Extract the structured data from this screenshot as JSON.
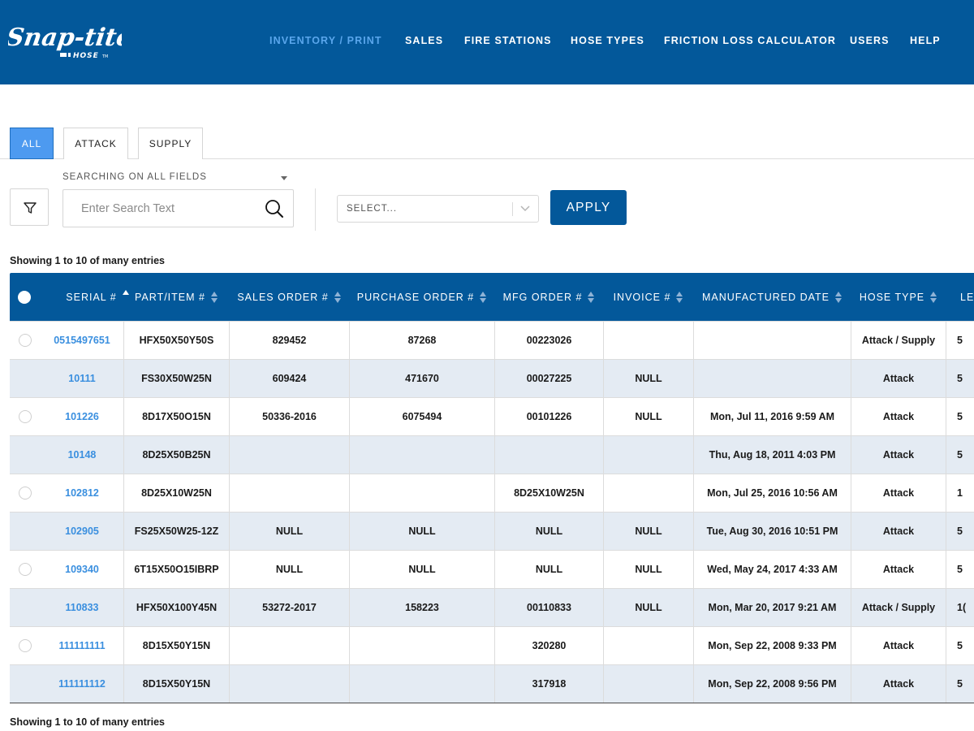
{
  "header": {
    "brand": "Snap-tite HOSE",
    "nav": [
      {
        "label": "INVENTORY / PRINT",
        "active": true
      },
      {
        "label": "SALES",
        "active": false
      },
      {
        "label": "FIRE STATIONS",
        "active": false
      },
      {
        "label": "HOSE TYPES",
        "active": false
      },
      {
        "label": "FRICTION LOSS CALCULATOR",
        "active": false
      },
      {
        "label": "USERS",
        "active": false
      },
      {
        "label": "HELP",
        "active": false
      }
    ]
  },
  "tabs": [
    {
      "label": "ALL",
      "active": true
    },
    {
      "label": "ATTACK",
      "active": false
    },
    {
      "label": "SUPPLY",
      "active": false
    }
  ],
  "search": {
    "scope_label": "SEARCHING ON ALL FIELDS",
    "placeholder": "Enter Search Text",
    "value": "",
    "select_placeholder": "SELECT...",
    "apply_label": "APPLY",
    "filter_icon": "filter-funnel-icon",
    "search_icon": "magnifier-icon"
  },
  "showing_top": "Showing 1 to 10 of many entries",
  "showing_bottom": "Showing 1 to 10 of many entries",
  "table": {
    "columns": [
      {
        "label": "SERIAL #",
        "sort": "asc"
      },
      {
        "label": "PART/ITEM #",
        "sort": "none"
      },
      {
        "label": "SALES ORDER #",
        "sort": "none"
      },
      {
        "label": "PURCHASE ORDER #",
        "sort": "none"
      },
      {
        "label": "MFG ORDER #",
        "sort": "none"
      },
      {
        "label": "INVOICE #",
        "sort": "none"
      },
      {
        "label": "MANUFACTURED DATE",
        "sort": "none"
      },
      {
        "label": "HOSE TYPE",
        "sort": "none"
      },
      {
        "label": "LE",
        "sort": "none"
      }
    ],
    "rows": [
      {
        "serial": "0515497651",
        "part": "HFX50X50Y50S",
        "sales_order": "829452",
        "purchase_order": "87268",
        "mfg_order": "00223026",
        "invoice": "",
        "date": "",
        "hose_type": "Attack / Supply",
        "le": "5"
      },
      {
        "serial": "10111",
        "part": "FS30X50W25N",
        "sales_order": "609424",
        "purchase_order": "471670",
        "mfg_order": "00027225",
        "invoice": "NULL",
        "date": "",
        "hose_type": "Attack",
        "le": "5"
      },
      {
        "serial": "101226",
        "part": "8D17X50O15N",
        "sales_order": "50336-2016",
        "purchase_order": "6075494",
        "mfg_order": "00101226",
        "invoice": "NULL",
        "date": "Mon, Jul 11, 2016 9:59 AM",
        "hose_type": "Attack",
        "le": "5"
      },
      {
        "serial": "10148",
        "part": "8D25X50B25N",
        "sales_order": "",
        "purchase_order": "",
        "mfg_order": "",
        "invoice": "",
        "date": "Thu, Aug 18, 2011 4:03 PM",
        "hose_type": "Attack",
        "le": "5"
      },
      {
        "serial": "102812",
        "part": "8D25X10W25N",
        "sales_order": "",
        "purchase_order": "",
        "mfg_order": "8D25X10W25N",
        "invoice": "",
        "date": "Mon, Jul 25, 2016 10:56 AM",
        "hose_type": "Attack",
        "le": "1"
      },
      {
        "serial": "102905",
        "part": "FS25X50W25-12Z",
        "sales_order": "NULL",
        "purchase_order": "NULL",
        "mfg_order": "NULL",
        "invoice": "NULL",
        "date": "Tue, Aug 30, 2016 10:51 PM",
        "hose_type": "Attack",
        "le": "5"
      },
      {
        "serial": "109340",
        "part": "6T15X50O15IBRP",
        "sales_order": "NULL",
        "purchase_order": "NULL",
        "mfg_order": "NULL",
        "invoice": "NULL",
        "date": "Wed, May 24, 2017 4:33 AM",
        "hose_type": "Attack",
        "le": "5"
      },
      {
        "serial": "110833",
        "part": "HFX50X100Y45N",
        "sales_order": "53272-2017",
        "purchase_order": "158223",
        "mfg_order": "00110833",
        "invoice": "NULL",
        "date": "Mon, Mar 20, 2017 9:21 AM",
        "hose_type": "Attack / Supply",
        "le": "1("
      },
      {
        "serial": "111111111",
        "part": "8D15X50Y15N",
        "sales_order": "",
        "purchase_order": "",
        "mfg_order": "320280",
        "invoice": "",
        "date": "Mon, Sep 22, 2008 9:33 PM",
        "hose_type": "Attack",
        "le": "5"
      },
      {
        "serial": "111111112",
        "part": "8D15X50Y15N",
        "sales_order": "",
        "purchase_order": "",
        "mfg_order": "317918",
        "invoice": "",
        "date": "Mon, Sep 22, 2008 9:56 PM",
        "hose_type": "Attack",
        "le": "5"
      }
    ]
  },
  "colors": {
    "brand_blue": "#03589a",
    "active_nav": "#5aa6ec",
    "active_tab": "#4d9af0",
    "link_blue": "#3a8fdf",
    "alt_row": "#e4ebf3"
  }
}
